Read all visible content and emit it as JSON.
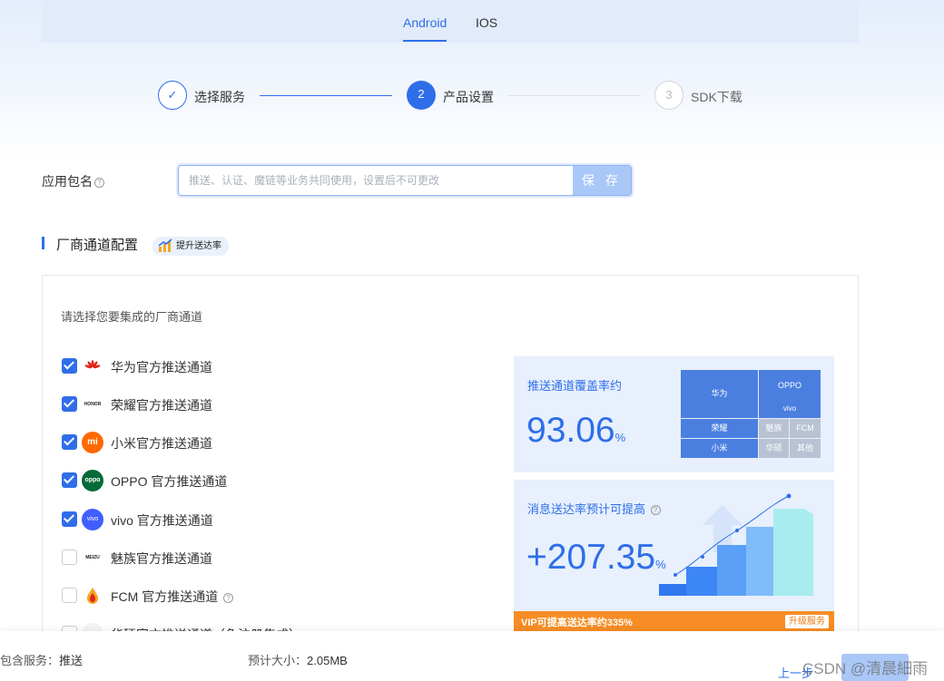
{
  "tabs": {
    "android": "Android",
    "ios": "IOS"
  },
  "steps": [
    {
      "num": "✓",
      "label": "选择服务",
      "state": "done"
    },
    {
      "num": "2",
      "label": "产品设置",
      "state": "active"
    },
    {
      "num": "3",
      "label": "SDK下载",
      "state": "pending"
    }
  ],
  "package": {
    "label": "应用包名",
    "placeholder": "推送、认证、魔链等业务共同使用，设置后不可更改",
    "save": "保 存"
  },
  "vendor": {
    "title": "厂商通道配置",
    "boost": "提升送达率",
    "hint": "请选择您要集成的厂商通道",
    "channels": [
      {
        "logo": "huawei-icon",
        "logo_text": "",
        "label": "华为官方推送通道",
        "checked": true
      },
      {
        "logo": "honor-icon",
        "logo_text": "HONOR",
        "label": "荣耀官方推送通道",
        "checked": true
      },
      {
        "logo": "xiaomi-icon",
        "logo_text": "mi",
        "label": "小米官方推送通道",
        "checked": true
      },
      {
        "logo": "oppo-icon",
        "logo_text": "oppo",
        "label": "OPPO 官方推送通道",
        "checked": true
      },
      {
        "logo": "vivo-icon",
        "logo_text": "vivo",
        "label": "vivo 官方推送通道",
        "checked": true
      },
      {
        "logo": "meizu-icon",
        "logo_text": "MEIZU",
        "label": "魅族官方推送通道",
        "checked": false
      },
      {
        "logo": "fcm-icon",
        "logo_text": "",
        "label": "FCM 官方推送通道",
        "checked": false
      },
      {
        "logo": "asus-icon",
        "logo_text": "",
        "label": "华硕官方推送通道（免注册集成）",
        "checked": false
      }
    ]
  },
  "coverage": {
    "title": "推送通道覆盖率约",
    "value": "93.06",
    "unit": "%",
    "treemap": {
      "huawei": "华为",
      "oppo": "OPPO",
      "vivo": "vivo",
      "honor": "荣耀",
      "xiaomi": "小米",
      "meizu": "魅族",
      "fcm": "FCM",
      "asus": "华硕",
      "other": "其他"
    }
  },
  "delivery": {
    "title": "消息送达率预计可提高",
    "value": "+207.35",
    "unit": "%"
  },
  "vip": {
    "text": "VIP可提高送达率约335%",
    "upgrade": "升级服务"
  },
  "footer": {
    "services_label": "包含服务：",
    "services": "推送",
    "size_label": "预计大小：",
    "size": "2.05MB",
    "prev": "上一步"
  },
  "watermark": "CSDN @清晨細雨",
  "colors": {
    "accent": "#2f6ee9",
    "vip": "#f78d24"
  }
}
